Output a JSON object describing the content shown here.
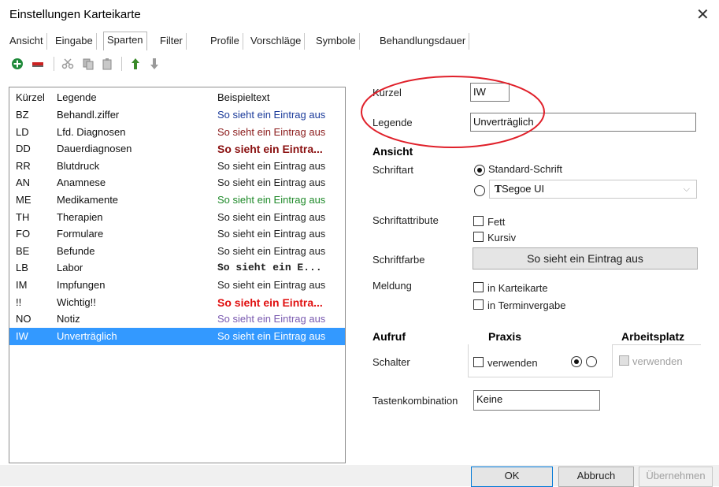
{
  "window": {
    "title": "Einstellungen Karteikarte",
    "close_glyph": "✕"
  },
  "tabs": [
    {
      "label": "Ansicht"
    },
    {
      "label": "Eingabe"
    },
    {
      "label": "Sparten"
    },
    {
      "label": "Filter"
    },
    {
      "label": "Profile"
    },
    {
      "label": "Vorschläge"
    },
    {
      "label": "Symbole"
    },
    {
      "label": "Behandlungsdauer"
    }
  ],
  "active_tab": "Sparten",
  "toolbar": {
    "icons": [
      "add-icon",
      "delete-icon",
      "cut-icon",
      "copy-icon",
      "paste-icon",
      "move-up-icon",
      "move-down-icon"
    ],
    "colors": {
      "add": "#1f8a3a",
      "delete": "#cc2222",
      "move": "#3a8a2a",
      "disabled": "#9a9a9a"
    }
  },
  "list": {
    "headers": {
      "code": "Kürzel",
      "legend": "Legende",
      "sample": "Beispieltext"
    },
    "rows": [
      {
        "code": "BZ",
        "legend": "Behandl.ziffer",
        "sample": "So sieht ein Eintrag aus",
        "color": "#1a3a9a"
      },
      {
        "code": "LD",
        "legend": "Lfd. Diagnosen",
        "sample": "So sieht ein Eintrag aus",
        "color": "#8a1a1a"
      },
      {
        "code": "DD",
        "legend": "Dauerdiagnosen",
        "sample": "So sieht ein Eintra...",
        "color": "#8a1010",
        "bold": true
      },
      {
        "code": "RR",
        "legend": "Blutdruck",
        "sample": "So sieht ein Eintrag aus",
        "color": "#222222"
      },
      {
        "code": "AN",
        "legend": "Anamnese",
        "sample": "So sieht ein Eintrag aus",
        "color": "#222222"
      },
      {
        "code": "ME",
        "legend": "Medikamente",
        "sample": "So sieht ein Eintrag aus",
        "color": "#1f8a2a"
      },
      {
        "code": "TH",
        "legend": "Therapien",
        "sample": "So sieht ein Eintrag aus",
        "color": "#222222"
      },
      {
        "code": "FO",
        "legend": "Formulare",
        "sample": "So sieht ein Eintrag aus",
        "color": "#222222"
      },
      {
        "code": "BE",
        "legend": "Befunde",
        "sample": "So sieht ein Eintrag aus",
        "color": "#222222"
      },
      {
        "code": "LB",
        "legend": "Labor",
        "sample": "So sieht ein E...",
        "color": "#222222",
        "mono": true
      },
      {
        "code": "IM",
        "legend": "Impfungen",
        "sample": "So sieht ein Eintrag aus",
        "color": "#222222"
      },
      {
        "code": "!!",
        "legend": "Wichtig!!",
        "sample": "So sieht ein Eintra...",
        "color": "#e01010",
        "bold": true
      },
      {
        "code": "NO",
        "legend": "Notiz",
        "sample": "So sieht ein Eintrag aus",
        "color": "#7a5ab0"
      },
      {
        "code": "IW",
        "legend": "Unverträglich",
        "sample": "So sieht ein Eintrag aus",
        "color": "#ffffff",
        "selected": true
      }
    ],
    "selection_color": "#3399ff"
  },
  "form": {
    "kuerzel_label": "Kürzel",
    "kuerzel_value": "IW",
    "legende_label": "Legende",
    "legende_value": "Unverträglich",
    "ansicht_header": "Ansicht",
    "schriftart_label": "Schriftart",
    "standard_schrift": "Standard-Schrift",
    "font_select_value": "Segoe UI",
    "font_icon": "truetype-font-icon",
    "schriftattribute_label": "Schriftattribute",
    "fett_label": "Fett",
    "kursiv_label": "Kursiv",
    "schriftfarbe_label": "Schriftfarbe",
    "schriftfarbe_button": "So sieht ein Eintrag aus",
    "meldung_label": "Meldung",
    "in_karteikarte": "in Karteikarte",
    "in_terminvergabe": "in Terminvergabe",
    "aufruf_header": "Aufruf",
    "praxis_header": "Praxis",
    "arbeitsplatz_header": "Arbeitsplatz",
    "schalter_label": "Schalter",
    "verwenden_praxis": "verwenden",
    "verwenden_arbeitsplatz": "verwenden",
    "tastenkombination_label": "Tastenkombination",
    "tastenkombination_value": "Keine",
    "highlight_color": "#e0202a"
  },
  "buttons": {
    "ok": "OK",
    "abbruch": "Abbruch",
    "uebernehmen": "Übernehmen"
  }
}
